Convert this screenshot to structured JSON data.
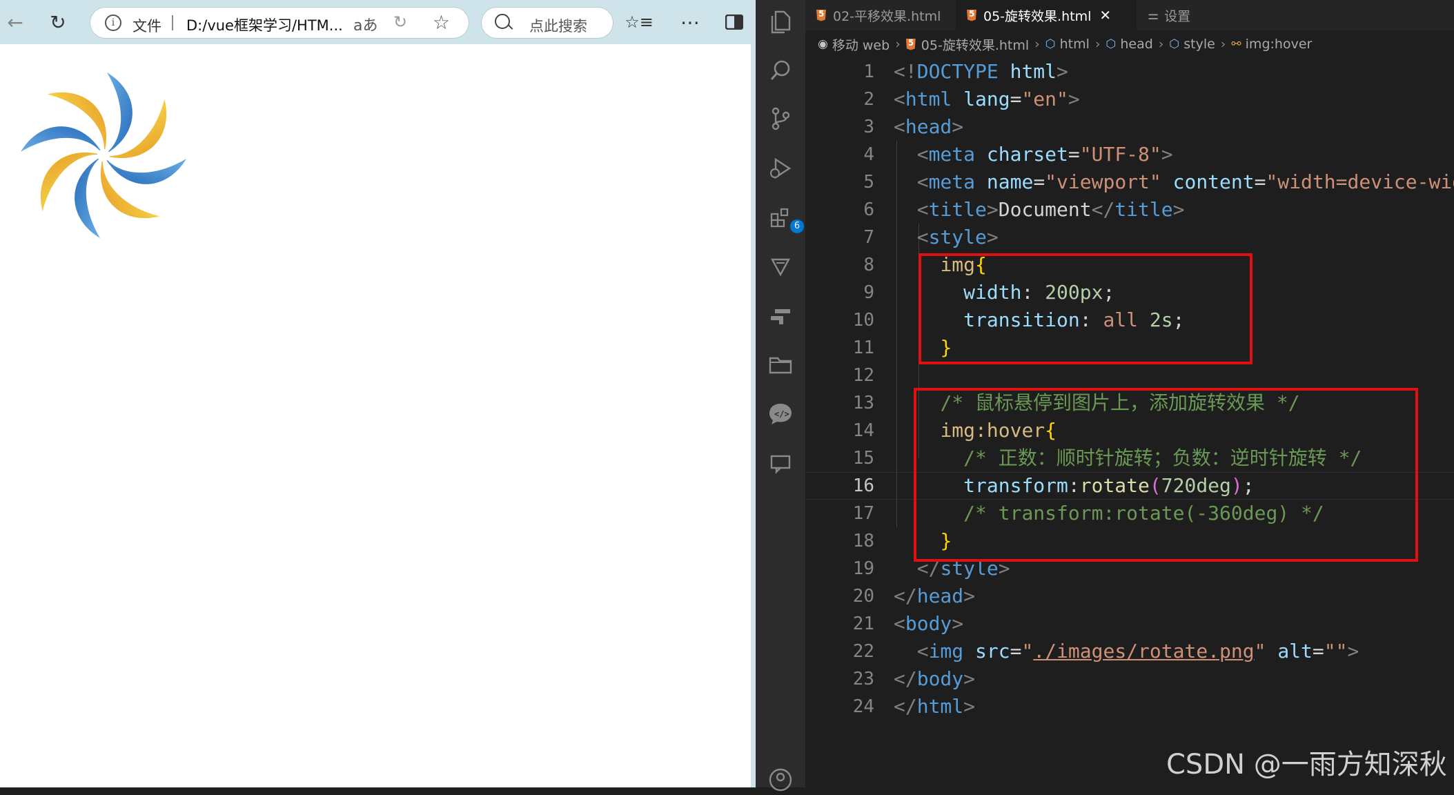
{
  "browser": {
    "back_icon": "arrow-left-icon",
    "reload_icon": "reload-icon",
    "address": {
      "file_label": "文件",
      "url": "D:/vue框架学习/HTM...",
      "read_aloud_label": "aあ"
    },
    "search_placeholder": "点此搜索",
    "toolbar_icons": [
      "favorites-icon",
      "more-icon",
      "sidebar-icon"
    ],
    "page_image": "rotate.png pinwheel"
  },
  "vscode": {
    "tabs": [
      {
        "label": "02-平移效果.html",
        "active": false
      },
      {
        "label": "05-旋转效果.html",
        "active": true
      },
      {
        "label": "设置",
        "active": false
      }
    ],
    "close_glyph": "✕",
    "breadcrumb": [
      "移动 web",
      "05-旋转效果.html",
      "html",
      "head",
      "style",
      "img:hover"
    ],
    "activity_badge": "6",
    "code_lines": [
      [
        [
          "t-punct",
          "<!"
        ],
        [
          "t-tag",
          "DOCTYPE"
        ],
        [
          "t-text",
          " "
        ],
        [
          "t-attr",
          "html"
        ],
        [
          "t-punct",
          ">"
        ]
      ],
      [
        [
          "t-punct",
          "<"
        ],
        [
          "t-tag",
          "html"
        ],
        [
          "t-text",
          " "
        ],
        [
          "t-attr",
          "lang"
        ],
        [
          "t-text",
          "="
        ],
        [
          "t-str",
          "\"en\""
        ],
        [
          "t-punct",
          ">"
        ]
      ],
      [
        [
          "t-punct",
          "<"
        ],
        [
          "t-tag",
          "head"
        ],
        [
          "t-punct",
          ">"
        ]
      ],
      [
        [
          "t-text",
          "  "
        ],
        [
          "t-punct",
          "<"
        ],
        [
          "t-tag",
          "meta"
        ],
        [
          "t-text",
          " "
        ],
        [
          "t-attr",
          "charset"
        ],
        [
          "t-text",
          "="
        ],
        [
          "t-str",
          "\"UTF-8\""
        ],
        [
          "t-punct",
          ">"
        ]
      ],
      [
        [
          "t-text",
          "  "
        ],
        [
          "t-punct",
          "<"
        ],
        [
          "t-tag",
          "meta"
        ],
        [
          "t-text",
          " "
        ],
        [
          "t-attr",
          "name"
        ],
        [
          "t-text",
          "="
        ],
        [
          "t-str",
          "\"viewport\""
        ],
        [
          "t-text",
          " "
        ],
        [
          "t-attr",
          "content"
        ],
        [
          "t-text",
          "="
        ],
        [
          "t-str",
          "\"width=device-wid"
        ]
      ],
      [
        [
          "t-text",
          "  "
        ],
        [
          "t-punct",
          "<"
        ],
        [
          "t-tag",
          "title"
        ],
        [
          "t-punct",
          ">"
        ],
        [
          "t-text",
          "Document"
        ],
        [
          "t-punct",
          "</"
        ],
        [
          "t-tag",
          "title"
        ],
        [
          "t-punct",
          ">"
        ]
      ],
      [
        [
          "t-text",
          "  "
        ],
        [
          "t-punct",
          "<"
        ],
        [
          "t-tag",
          "style"
        ],
        [
          "t-punct",
          ">"
        ]
      ],
      [
        [
          "t-text",
          "    "
        ],
        [
          "t-sel",
          "img"
        ],
        [
          "t-brace",
          "{"
        ]
      ],
      [
        [
          "t-text",
          "      "
        ],
        [
          "t-prop",
          "width"
        ],
        [
          "t-text",
          ": "
        ],
        [
          "t-num",
          "200px"
        ],
        [
          "t-text",
          ";"
        ]
      ],
      [
        [
          "t-text",
          "      "
        ],
        [
          "t-prop",
          "transition"
        ],
        [
          "t-text",
          ": "
        ],
        [
          "t-val",
          "all"
        ],
        [
          "t-text",
          " "
        ],
        [
          "t-num",
          "2s"
        ],
        [
          "t-text",
          ";"
        ]
      ],
      [
        [
          "t-text",
          "    "
        ],
        [
          "t-brace",
          "}"
        ]
      ],
      [],
      [
        [
          "t-text",
          "    "
        ],
        [
          "t-comment",
          "/* 鼠标悬停到图片上，添加旋转效果 */"
        ]
      ],
      [
        [
          "t-text",
          "    "
        ],
        [
          "t-sel",
          "img:hover"
        ],
        [
          "t-brace",
          "{"
        ]
      ],
      [
        [
          "t-text",
          "      "
        ],
        [
          "t-comment",
          "/* 正数：顺时针旋转；负数：逆时针旋转 */"
        ]
      ],
      [
        [
          "t-text",
          "      "
        ],
        [
          "t-prop",
          "transform"
        ],
        [
          "t-text",
          ":"
        ],
        [
          "t-func",
          "rotate"
        ],
        [
          "t-paren",
          "("
        ],
        [
          "t-num",
          "720deg"
        ],
        [
          "t-paren",
          ")"
        ],
        [
          "t-text",
          ";"
        ]
      ],
      [
        [
          "t-text",
          "      "
        ],
        [
          "t-comment",
          "/* transform:rotate(-360deg) */"
        ]
      ],
      [
        [
          "t-text",
          "    "
        ],
        [
          "t-brace",
          "}"
        ]
      ],
      [
        [
          "t-text",
          "  "
        ],
        [
          "t-punct",
          "</"
        ],
        [
          "t-tag",
          "style"
        ],
        [
          "t-punct",
          ">"
        ]
      ],
      [
        [
          "t-punct",
          "</"
        ],
        [
          "t-tag",
          "head"
        ],
        [
          "t-punct",
          ">"
        ]
      ],
      [
        [
          "t-punct",
          "<"
        ],
        [
          "t-tag",
          "body"
        ],
        [
          "t-punct",
          ">"
        ]
      ],
      [
        [
          "t-text",
          "  "
        ],
        [
          "t-punct",
          "<"
        ],
        [
          "t-tag",
          "img"
        ],
        [
          "t-text",
          " "
        ],
        [
          "t-attr",
          "src"
        ],
        [
          "t-text",
          "="
        ],
        [
          "t-str",
          "\""
        ],
        [
          "t-link",
          "./images/rotate.png"
        ],
        [
          "t-str",
          "\""
        ],
        [
          "t-text",
          " "
        ],
        [
          "t-attr",
          "alt"
        ],
        [
          "t-text",
          "="
        ],
        [
          "t-str",
          "\"\""
        ],
        [
          "t-punct",
          ">"
        ]
      ],
      [
        [
          "t-punct",
          "</"
        ],
        [
          "t-tag",
          "body"
        ],
        [
          "t-punct",
          ">"
        ]
      ],
      [
        [
          "t-punct",
          "</"
        ],
        [
          "t-tag",
          "html"
        ],
        [
          "t-punct",
          ">"
        ]
      ]
    ],
    "current_line": 16,
    "highlight_color": "#e01010"
  },
  "watermark": "CSDN @一雨方知深秋"
}
